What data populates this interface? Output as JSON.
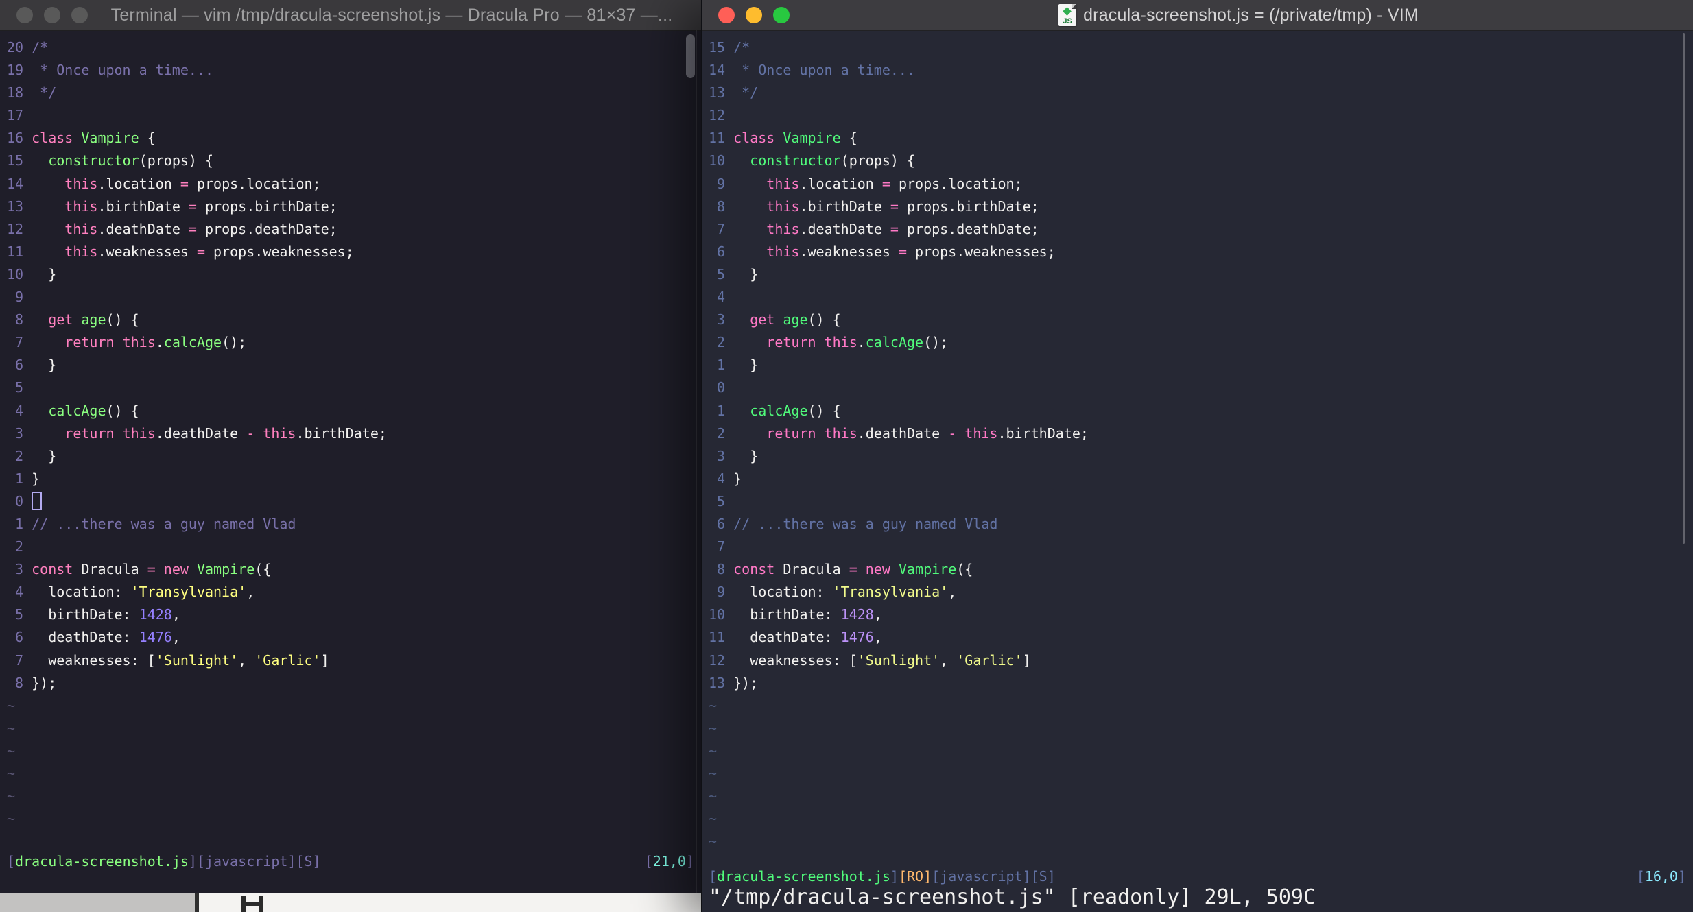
{
  "desktop": {
    "strip_left_bg": "#c3c2c1",
    "strip_right_bg": "#f4f3f1"
  },
  "left_window": {
    "title": "Terminal — vim /tmp/dracula-screenshot.js — Dracula Pro — 81×37 —...",
    "titlebar_bg": "#3a393c",
    "title_color": "#9f9fa0",
    "traffic_lights": {
      "close": "#595959",
      "minimize": "#595959",
      "zoom": "#595959"
    },
    "colors": {
      "bg": "#1f1e29",
      "fg": "#f2f1ef",
      "comment": "#7970a9",
      "linenr": "#7970a9",
      "pink": "#ff80bf",
      "green": "#8aff80",
      "yellow": "#ffff80",
      "purple": "#9580ff",
      "cyan": "#80ffea",
      "orange": "#ffca80",
      "bracket": "#7970a9",
      "tilde": "#575370",
      "cursor": "#b3aaf0"
    },
    "tilde": "~",
    "tilde_count": 6,
    "lines": [
      {
        "n": "20",
        "segs": [
          [
            "comment",
            "/*"
          ]
        ]
      },
      {
        "n": "19",
        "segs": [
          [
            "comment",
            " * Once upon a time..."
          ]
        ]
      },
      {
        "n": "18",
        "segs": [
          [
            "comment",
            " */"
          ]
        ]
      },
      {
        "n": "17",
        "segs": []
      },
      {
        "n": "16",
        "segs": [
          [
            "pink",
            "class"
          ],
          [
            "fg",
            " "
          ],
          [
            "green",
            "Vampire"
          ],
          [
            "fg",
            " {"
          ]
        ]
      },
      {
        "n": "15",
        "segs": [
          [
            "fg",
            "  "
          ],
          [
            "green",
            "constructor"
          ],
          [
            "fg",
            "(props) {"
          ]
        ]
      },
      {
        "n": "14",
        "segs": [
          [
            "fg",
            "    "
          ],
          [
            "pink",
            "this"
          ],
          [
            "fg",
            ".location "
          ],
          [
            "pink",
            "="
          ],
          [
            "fg",
            " props.location;"
          ]
        ]
      },
      {
        "n": "13",
        "segs": [
          [
            "fg",
            "    "
          ],
          [
            "pink",
            "this"
          ],
          [
            "fg",
            ".birthDate "
          ],
          [
            "pink",
            "="
          ],
          [
            "fg",
            " props.birthDate;"
          ]
        ]
      },
      {
        "n": "12",
        "segs": [
          [
            "fg",
            "    "
          ],
          [
            "pink",
            "this"
          ],
          [
            "fg",
            ".deathDate "
          ],
          [
            "pink",
            "="
          ],
          [
            "fg",
            " props.deathDate;"
          ]
        ]
      },
      {
        "n": "11",
        "segs": [
          [
            "fg",
            "    "
          ],
          [
            "pink",
            "this"
          ],
          [
            "fg",
            ".weaknesses "
          ],
          [
            "pink",
            "="
          ],
          [
            "fg",
            " props.weaknesses;"
          ]
        ]
      },
      {
        "n": "10",
        "segs": [
          [
            "fg",
            "  }"
          ]
        ]
      },
      {
        "n": "9",
        "segs": []
      },
      {
        "n": "8",
        "segs": [
          [
            "fg",
            "  "
          ],
          [
            "pink",
            "get"
          ],
          [
            "fg",
            " "
          ],
          [
            "green",
            "age"
          ],
          [
            "fg",
            "() {"
          ]
        ]
      },
      {
        "n": "7",
        "segs": [
          [
            "fg",
            "    "
          ],
          [
            "pink",
            "return"
          ],
          [
            "fg",
            " "
          ],
          [
            "pink",
            "this"
          ],
          [
            "fg",
            "."
          ],
          [
            "green",
            "calcAge"
          ],
          [
            "fg",
            "();"
          ]
        ]
      },
      {
        "n": "6",
        "segs": [
          [
            "fg",
            "  }"
          ]
        ]
      },
      {
        "n": "5",
        "segs": []
      },
      {
        "n": "4",
        "segs": [
          [
            "fg",
            "  "
          ],
          [
            "green",
            "calcAge"
          ],
          [
            "fg",
            "() {"
          ]
        ]
      },
      {
        "n": "3",
        "segs": [
          [
            "fg",
            "    "
          ],
          [
            "pink",
            "return"
          ],
          [
            "fg",
            " "
          ],
          [
            "pink",
            "this"
          ],
          [
            "fg",
            ".deathDate "
          ],
          [
            "pink",
            "-"
          ],
          [
            "fg",
            " "
          ],
          [
            "pink",
            "this"
          ],
          [
            "fg",
            ".birthDate;"
          ]
        ]
      },
      {
        "n": "2",
        "segs": [
          [
            "fg",
            "  }"
          ]
        ]
      },
      {
        "n": "1",
        "segs": [
          [
            "fg",
            "}"
          ]
        ]
      },
      {
        "n": "0",
        "segs": [],
        "cursor": true
      },
      {
        "n": "1",
        "segs": [
          [
            "comment",
            "// ...there was a guy named Vlad"
          ]
        ]
      },
      {
        "n": "2",
        "segs": []
      },
      {
        "n": "3",
        "segs": [
          [
            "pink",
            "const"
          ],
          [
            "fg",
            " Dracula "
          ],
          [
            "pink",
            "="
          ],
          [
            "fg",
            " "
          ],
          [
            "pink",
            "new"
          ],
          [
            "fg",
            " "
          ],
          [
            "green",
            "Vampire"
          ],
          [
            "fg",
            "({"
          ]
        ]
      },
      {
        "n": "4",
        "segs": [
          [
            "fg",
            "  location: "
          ],
          [
            "yellow",
            "'Transylvania'"
          ],
          [
            "fg",
            ","
          ]
        ]
      },
      {
        "n": "5",
        "segs": [
          [
            "fg",
            "  birthDate: "
          ],
          [
            "purple",
            "1428"
          ],
          [
            "fg",
            ","
          ]
        ]
      },
      {
        "n": "6",
        "segs": [
          [
            "fg",
            "  deathDate: "
          ],
          [
            "purple",
            "1476"
          ],
          [
            "fg",
            ","
          ]
        ]
      },
      {
        "n": "7",
        "segs": [
          [
            "fg",
            "  weaknesses: ["
          ],
          [
            "yellow",
            "'Sunlight'"
          ],
          [
            "fg",
            ", "
          ],
          [
            "yellow",
            "'Garlic'"
          ],
          [
            "fg",
            "]"
          ]
        ]
      },
      {
        "n": "8",
        "segs": [
          [
            "fg",
            "});"
          ]
        ]
      }
    ],
    "status_left": [
      [
        "bracket",
        "["
      ],
      [
        "green",
        "dracula-screenshot.js"
      ],
      [
        "bracket",
        "][javascript][S]"
      ]
    ],
    "status_right": [
      [
        "bracket",
        "["
      ],
      [
        "cyan",
        "21,0"
      ],
      [
        "bracket",
        "]"
      ]
    ]
  },
  "right_window": {
    "title": "dracula-screenshot.js = (/private/tmp) - VIM",
    "icon_label": "JS",
    "titlebar_bg": "#3d3c40",
    "title_color": "#d6d5d6",
    "traffic_lights": {
      "close": "#ff5f57",
      "minimize": "#febc2e",
      "zoom": "#28c840"
    },
    "colors": {
      "bg": "#262834",
      "fg": "#f2f1ef",
      "comment": "#6272a4",
      "linenr": "#6272a4",
      "pink": "#ff79c6",
      "green": "#50fa7b",
      "yellow": "#f1fa8c",
      "purple": "#bd93f9",
      "cyan": "#8be9fd",
      "orange": "#ffb86c",
      "bracket": "#6272a4",
      "tilde": "#4d5a7d",
      "cursor": "#f8f8f2"
    },
    "tilde": "~",
    "tilde_count": 7,
    "lines": [
      {
        "n": "15",
        "segs": [
          [
            "comment",
            "/*"
          ]
        ]
      },
      {
        "n": "14",
        "segs": [
          [
            "comment",
            " * Once upon a time..."
          ]
        ]
      },
      {
        "n": "13",
        "segs": [
          [
            "comment",
            " */"
          ]
        ]
      },
      {
        "n": "12",
        "segs": []
      },
      {
        "n": "11",
        "segs": [
          [
            "pink",
            "class"
          ],
          [
            "fg",
            " "
          ],
          [
            "green",
            "Vampire"
          ],
          [
            "fg",
            " {"
          ]
        ]
      },
      {
        "n": "10",
        "segs": [
          [
            "fg",
            "  "
          ],
          [
            "green",
            "constructor"
          ],
          [
            "fg",
            "(props) {"
          ]
        ]
      },
      {
        "n": "9",
        "segs": [
          [
            "fg",
            "    "
          ],
          [
            "pink",
            "this"
          ],
          [
            "fg",
            ".location "
          ],
          [
            "pink",
            "="
          ],
          [
            "fg",
            " props.location;"
          ]
        ]
      },
      {
        "n": "8",
        "segs": [
          [
            "fg",
            "    "
          ],
          [
            "pink",
            "this"
          ],
          [
            "fg",
            ".birthDate "
          ],
          [
            "pink",
            "="
          ],
          [
            "fg",
            " props.birthDate;"
          ]
        ]
      },
      {
        "n": "7",
        "segs": [
          [
            "fg",
            "    "
          ],
          [
            "pink",
            "this"
          ],
          [
            "fg",
            ".deathDate "
          ],
          [
            "pink",
            "="
          ],
          [
            "fg",
            " props.deathDate;"
          ]
        ]
      },
      {
        "n": "6",
        "segs": [
          [
            "fg",
            "    "
          ],
          [
            "pink",
            "this"
          ],
          [
            "fg",
            ".weaknesses "
          ],
          [
            "pink",
            "="
          ],
          [
            "fg",
            " props.weaknesses;"
          ]
        ]
      },
      {
        "n": "5",
        "segs": [
          [
            "fg",
            "  }"
          ]
        ]
      },
      {
        "n": "4",
        "segs": []
      },
      {
        "n": "3",
        "segs": [
          [
            "fg",
            "  "
          ],
          [
            "pink",
            "get"
          ],
          [
            "fg",
            " "
          ],
          [
            "green",
            "age"
          ],
          [
            "fg",
            "() {"
          ]
        ]
      },
      {
        "n": "2",
        "segs": [
          [
            "fg",
            "    "
          ],
          [
            "pink",
            "return"
          ],
          [
            "fg",
            " "
          ],
          [
            "pink",
            "this"
          ],
          [
            "fg",
            "."
          ],
          [
            "green",
            "calcAge"
          ],
          [
            "fg",
            "();"
          ]
        ]
      },
      {
        "n": "1",
        "segs": [
          [
            "fg",
            "  }"
          ]
        ]
      },
      {
        "n": "0",
        "segs": []
      },
      {
        "n": "1",
        "segs": [
          [
            "fg",
            "  "
          ],
          [
            "green",
            "calcAge"
          ],
          [
            "fg",
            "() {"
          ]
        ]
      },
      {
        "n": "2",
        "segs": [
          [
            "fg",
            "    "
          ],
          [
            "pink",
            "return"
          ],
          [
            "fg",
            " "
          ],
          [
            "pink",
            "this"
          ],
          [
            "fg",
            ".deathDate "
          ],
          [
            "pink",
            "-"
          ],
          [
            "fg",
            " "
          ],
          [
            "pink",
            "this"
          ],
          [
            "fg",
            ".birthDate;"
          ]
        ]
      },
      {
        "n": "3",
        "segs": [
          [
            "fg",
            "  }"
          ]
        ]
      },
      {
        "n": "4",
        "segs": [
          [
            "fg",
            "}"
          ]
        ]
      },
      {
        "n": "5",
        "segs": []
      },
      {
        "n": "6",
        "segs": [
          [
            "comment",
            "// ...there was a guy named Vlad"
          ]
        ]
      },
      {
        "n": "7",
        "segs": []
      },
      {
        "n": "8",
        "segs": [
          [
            "pink",
            "const"
          ],
          [
            "fg",
            " Dracula "
          ],
          [
            "pink",
            "="
          ],
          [
            "fg",
            " "
          ],
          [
            "pink",
            "new"
          ],
          [
            "fg",
            " "
          ],
          [
            "green",
            "Vampire"
          ],
          [
            "fg",
            "({"
          ]
        ]
      },
      {
        "n": "9",
        "segs": [
          [
            "fg",
            "  location: "
          ],
          [
            "yellow",
            "'Transylvania'"
          ],
          [
            "fg",
            ","
          ]
        ]
      },
      {
        "n": "10",
        "segs": [
          [
            "fg",
            "  birthDate: "
          ],
          [
            "purple",
            "1428"
          ],
          [
            "fg",
            ","
          ]
        ]
      },
      {
        "n": "11",
        "segs": [
          [
            "fg",
            "  deathDate: "
          ],
          [
            "purple",
            "1476"
          ],
          [
            "fg",
            ","
          ]
        ]
      },
      {
        "n": "12",
        "segs": [
          [
            "fg",
            "  weaknesses: ["
          ],
          [
            "yellow",
            "'Sunlight'"
          ],
          [
            "fg",
            ", "
          ],
          [
            "yellow",
            "'Garlic'"
          ],
          [
            "fg",
            "]"
          ]
        ]
      },
      {
        "n": "13",
        "segs": [
          [
            "fg",
            "});"
          ]
        ]
      }
    ],
    "status_left": [
      [
        "bracket",
        "["
      ],
      [
        "green",
        "dracula-screenshot.js"
      ],
      [
        "bracket",
        "]"
      ],
      [
        "orange",
        "[RO]"
      ],
      [
        "bracket",
        "[javascript][S]"
      ]
    ],
    "status_right": [
      [
        "bracket",
        "["
      ],
      [
        "cyan",
        "16,0"
      ],
      [
        "bracket",
        "]"
      ]
    ],
    "cmdline": "\"/tmp/dracula-screenshot.js\" [readonly] 29L, 509C"
  }
}
